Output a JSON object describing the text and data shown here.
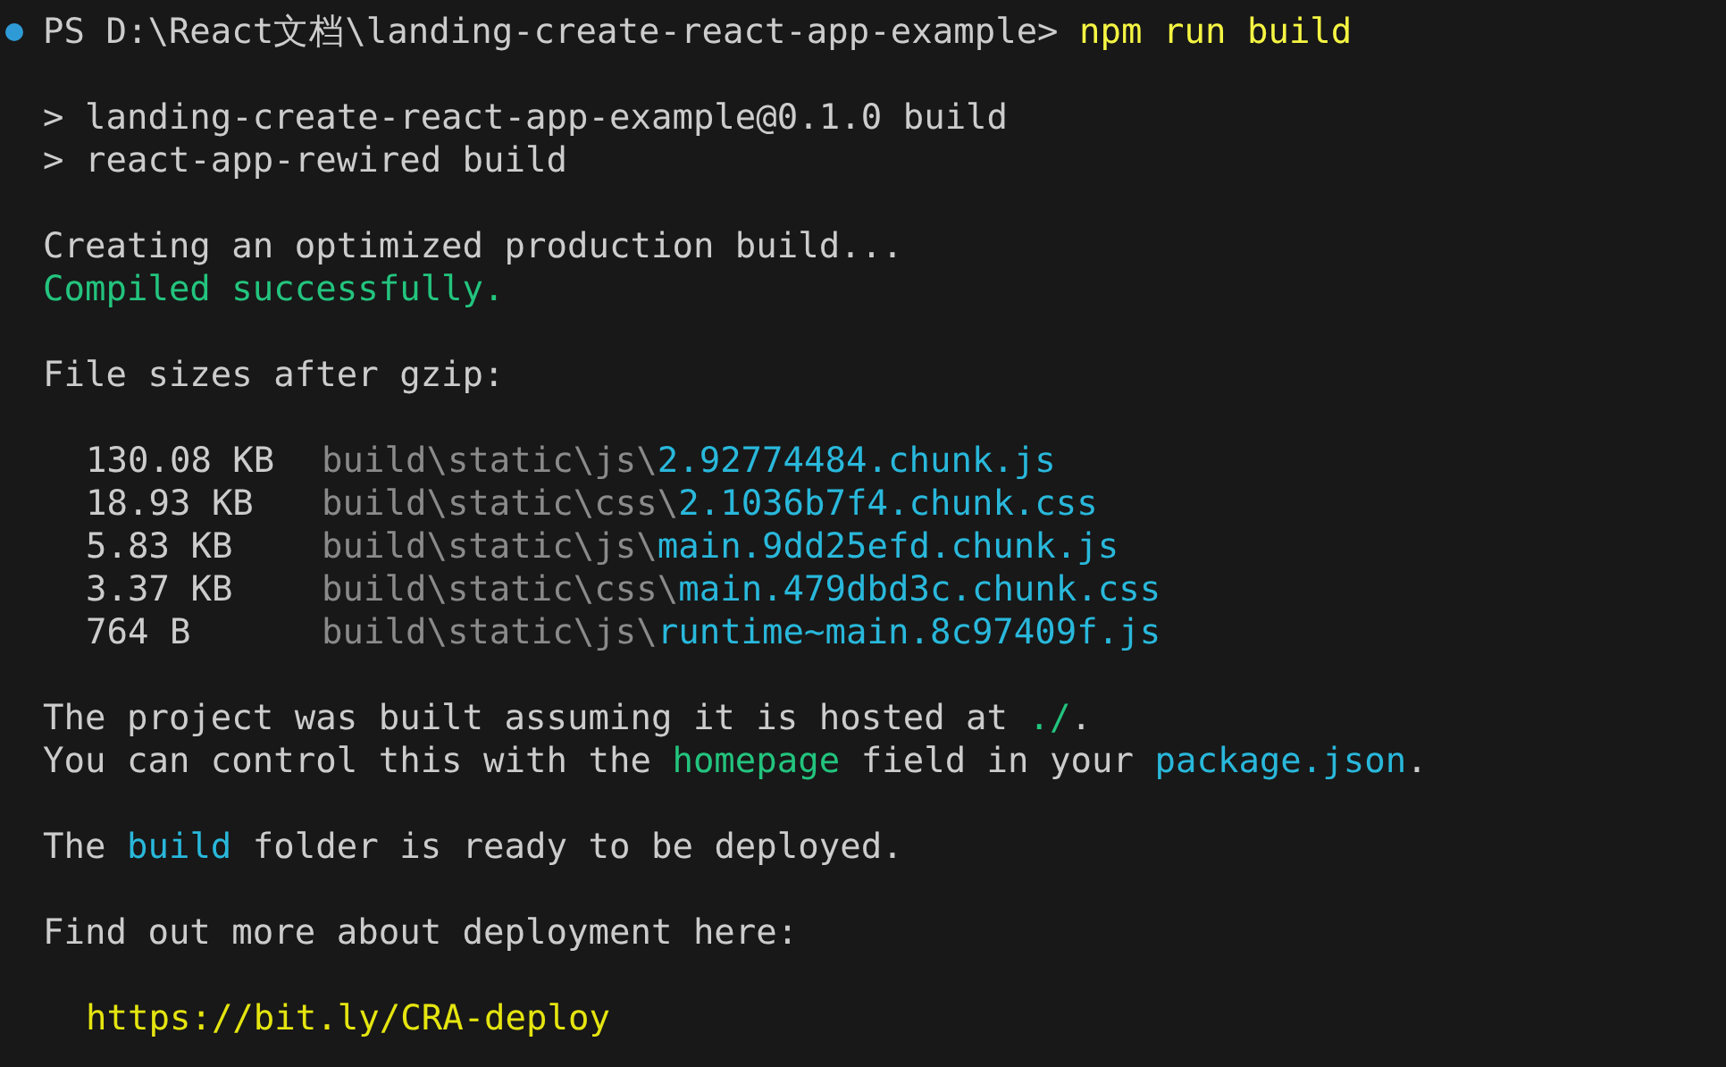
{
  "terminal": {
    "blocks": [
      {
        "lines": [
          {
            "kind": "prompt",
            "color": "#2f9bd6",
            "segments": [
              {
                "kind": "plain",
                "text": "PS D:\\React文档\\landing-create-react-app-example> "
              },
              {
                "kind": "command",
                "text": "npm run build"
              }
            ]
          }
        ]
      },
      {
        "lines": [
          {
            "kind": "plain",
            "segments": [
              {
                "kind": "plain",
                "text": "> landing-create-react-app-example@0.1.0 build"
              }
            ]
          },
          {
            "kind": "plain",
            "segments": [
              {
                "kind": "plain",
                "text": "> react-app-rewired build"
              }
            ]
          }
        ]
      },
      {
        "lines": [
          {
            "kind": "plain",
            "segments": [
              {
                "kind": "plain",
                "text": "Creating an optimized production build..."
              }
            ]
          },
          {
            "kind": "plain",
            "segments": [
              {
                "kind": "success",
                "text": "Compiled successfully."
              }
            ]
          }
        ]
      },
      {
        "lines": [
          {
            "kind": "plain",
            "segments": [
              {
                "kind": "plain",
                "text": "File sizes after gzip:"
              }
            ]
          }
        ]
      },
      {
        "lines": [
          {
            "kind": "file",
            "size": "130.08 KB",
            "segments": [
              {
                "kind": "dim",
                "text": "build\\static\\js\\"
              },
              {
                "kind": "file",
                "text": "2.92774484.chunk.js"
              }
            ]
          },
          {
            "kind": "file",
            "size": "18.93 KB",
            "segments": [
              {
                "kind": "dim",
                "text": "build\\static\\css\\"
              },
              {
                "kind": "file",
                "text": "2.1036b7f4.chunk.css"
              }
            ]
          },
          {
            "kind": "file",
            "size": "5.83 KB",
            "segments": [
              {
                "kind": "dim",
                "text": "build\\static\\js\\"
              },
              {
                "kind": "file",
                "text": "main.9dd25efd.chunk.js"
              }
            ]
          },
          {
            "kind": "file",
            "size": "3.37 KB",
            "segments": [
              {
                "kind": "dim",
                "text": "build\\static\\css\\"
              },
              {
                "kind": "file",
                "text": "main.479dbd3c.chunk.css"
              }
            ]
          },
          {
            "kind": "file",
            "size": "764 B",
            "segments": [
              {
                "kind": "dim",
                "text": "build\\static\\js\\"
              },
              {
                "kind": "file",
                "text": "runtime~main.8c97409f.js"
              }
            ]
          }
        ]
      },
      {
        "lines": [
          {
            "kind": "plain",
            "segments": [
              {
                "kind": "plain",
                "text": "The project was built assuming it is hosted at "
              },
              {
                "kind": "success",
                "text": "./"
              },
              {
                "kind": "plain",
                "text": "."
              }
            ]
          },
          {
            "kind": "plain",
            "segments": [
              {
                "kind": "plain",
                "text": "You can control this with the "
              },
              {
                "kind": "success",
                "text": "homepage"
              },
              {
                "kind": "plain",
                "text": " field in your "
              },
              {
                "kind": "file",
                "text": "package.json"
              },
              {
                "kind": "plain",
                "text": "."
              }
            ]
          }
        ]
      },
      {
        "lines": [
          {
            "kind": "plain",
            "segments": [
              {
                "kind": "plain",
                "text": "The "
              },
              {
                "kind": "file",
                "text": "build"
              },
              {
                "kind": "plain",
                "text": " folder is ready to be deployed."
              }
            ]
          }
        ]
      },
      {
        "lines": [
          {
            "kind": "plain",
            "segments": [
              {
                "kind": "plain",
                "text": "Find out more about deployment here:"
              }
            ]
          }
        ]
      },
      {
        "lines": [
          {
            "kind": "indented",
            "segments": [
              {
                "kind": "url",
                "text": "https://bit.ly/CRA-deploy"
              }
            ]
          }
        ]
      }
    ]
  }
}
